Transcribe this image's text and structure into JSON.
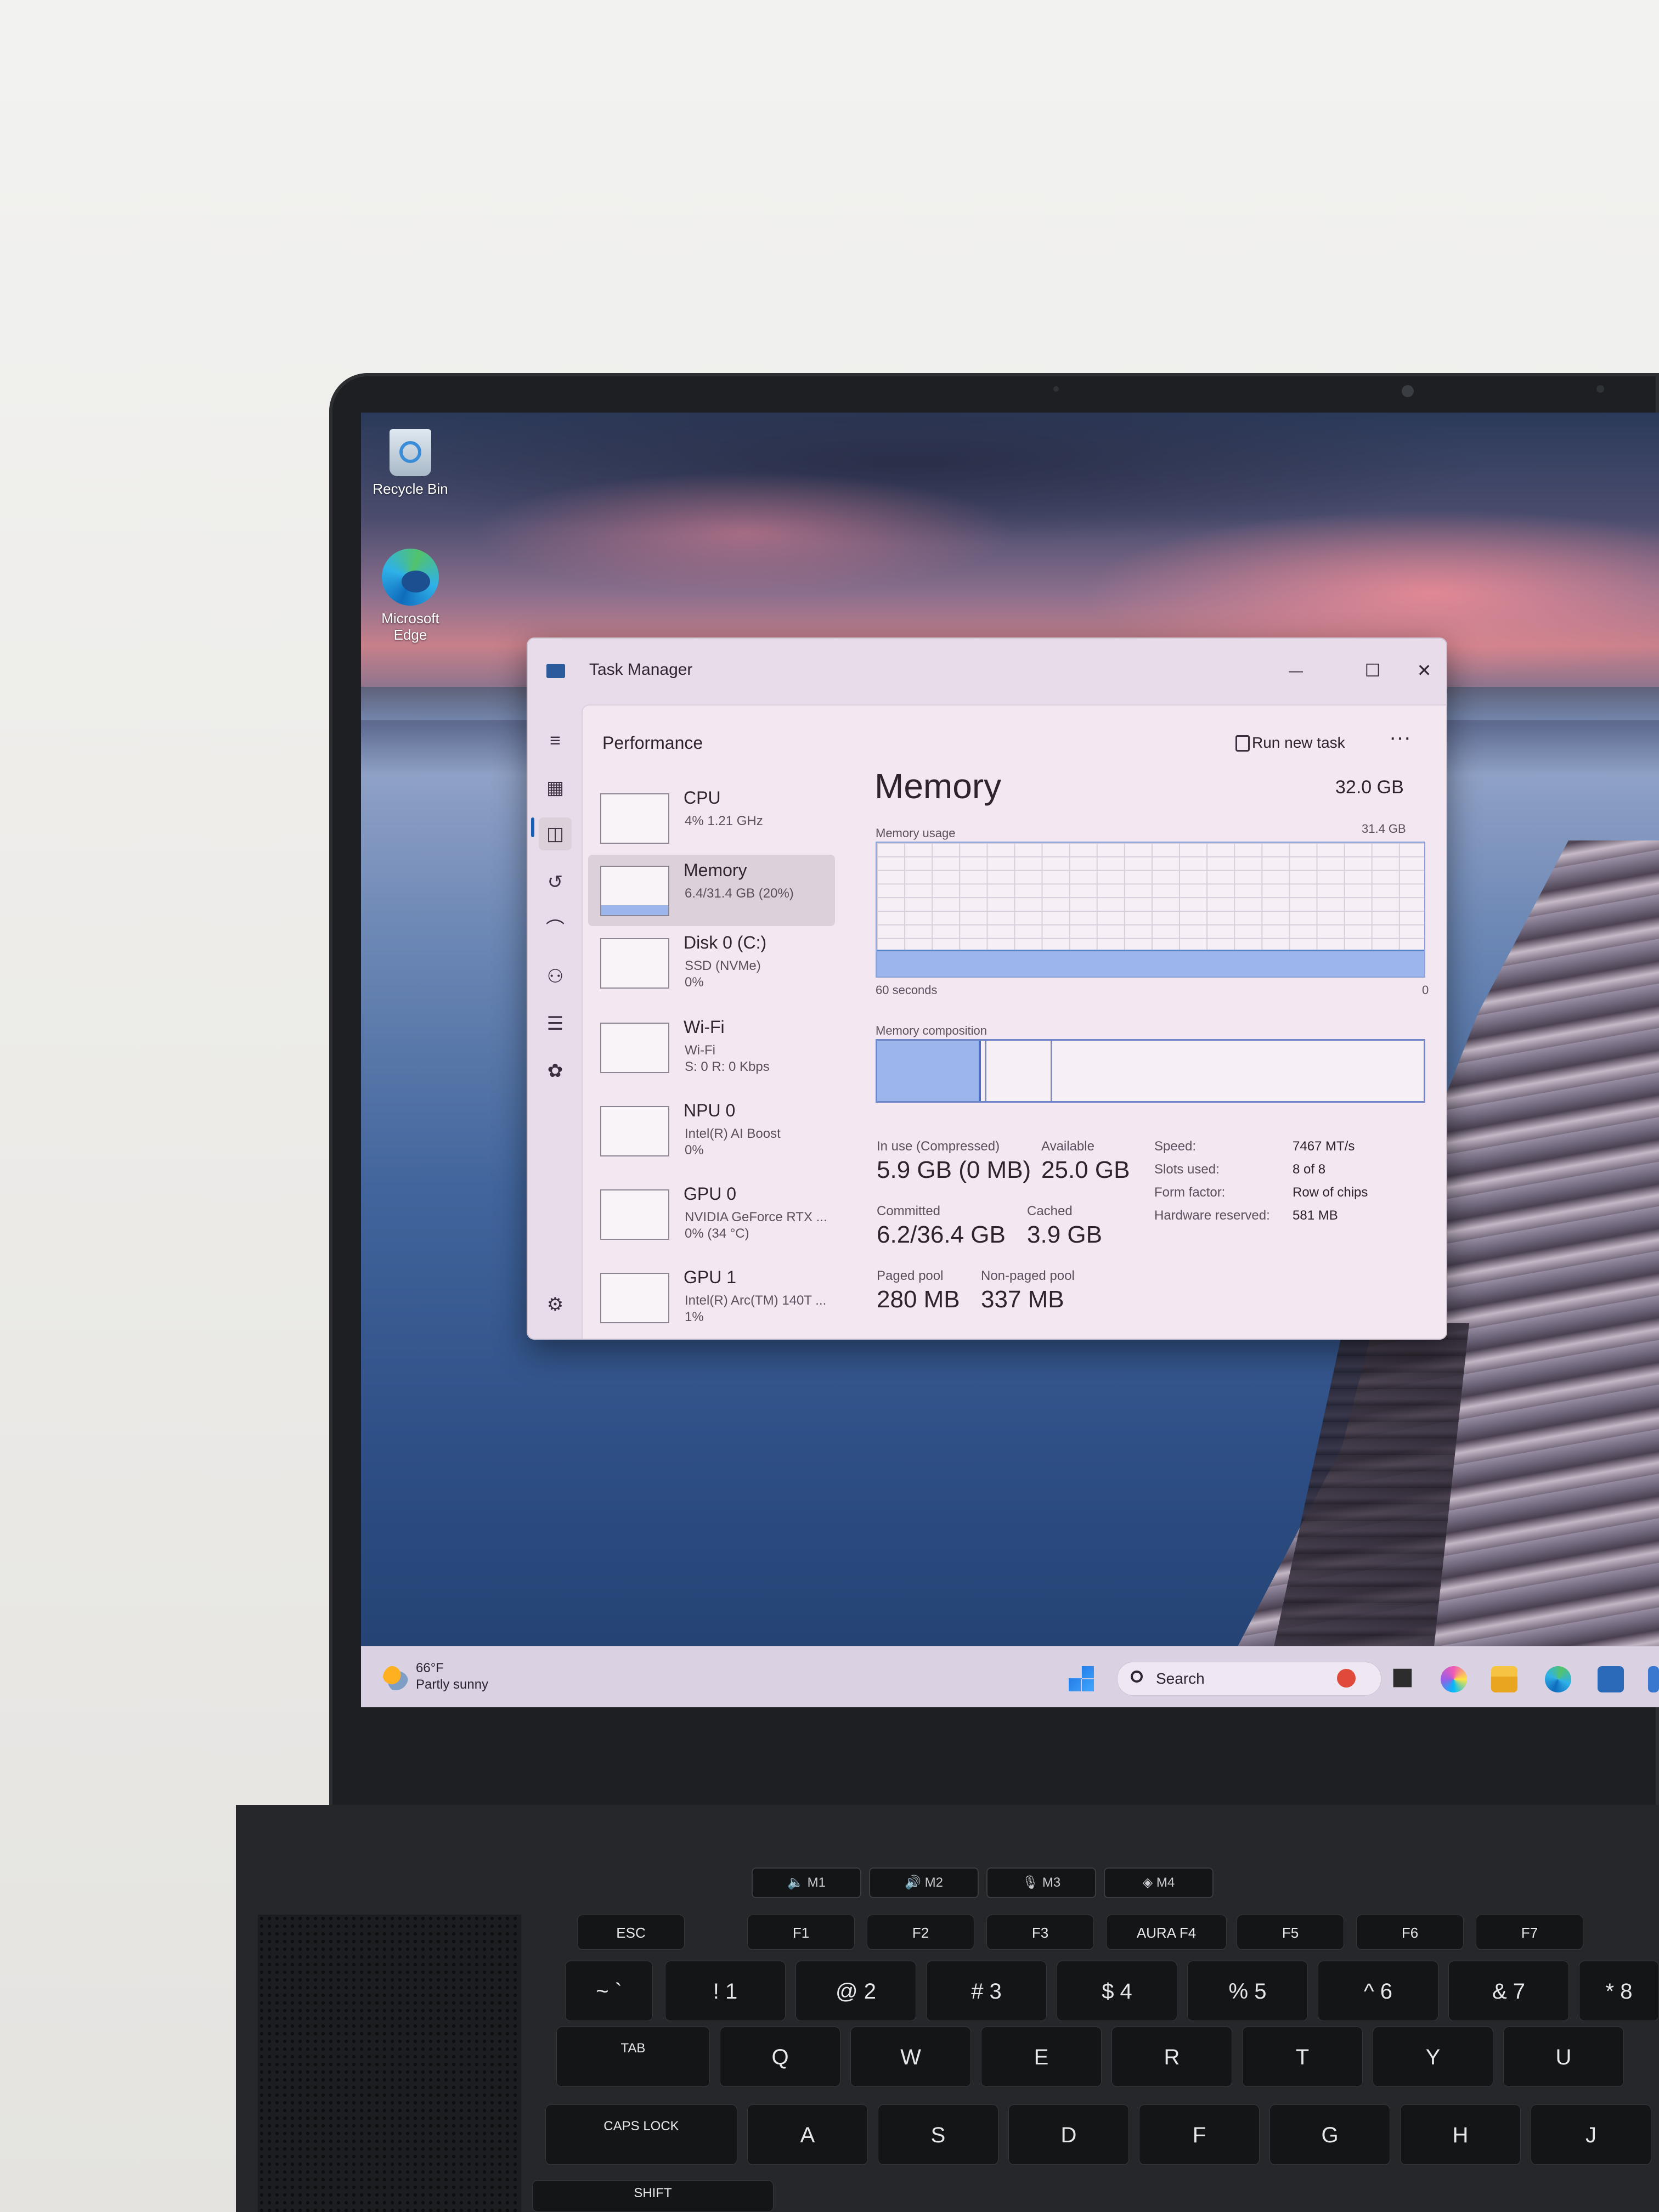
{
  "desktop": {
    "icons": [
      {
        "label": "Recycle Bin",
        "icon": "recycle-bin-icon"
      },
      {
        "label": "Microsoft\nEdge",
        "icon": "edge-icon"
      }
    ]
  },
  "window": {
    "title": "Task Manager",
    "controls": {
      "minimize": "—",
      "maximize": "☐",
      "close": "✕"
    }
  },
  "nav": {
    "rail_icons": [
      "hamburger-icon",
      "processes-icon",
      "performance-icon",
      "app-history-icon",
      "startup-icon",
      "users-icon",
      "details-icon",
      "services-icon",
      "settings-icon"
    ]
  },
  "header": {
    "page": "Performance",
    "run_task": "Run new task",
    "more": "···"
  },
  "devices": [
    {
      "name": "CPU",
      "sub1": "4%  1.21 GHz",
      "sub2": ""
    },
    {
      "name": "Memory",
      "sub1": "6.4/31.4 GB (20%)",
      "sub2": ""
    },
    {
      "name": "Disk 0 (C:)",
      "sub1": "SSD (NVMe)",
      "sub2": "0%"
    },
    {
      "name": "Wi-Fi",
      "sub1": "Wi-Fi",
      "sub2": "S: 0  R: 0 Kbps"
    },
    {
      "name": "NPU 0",
      "sub1": "Intel(R) AI Boost",
      "sub2": "0%"
    },
    {
      "name": "GPU 0",
      "sub1": "NVIDIA GeForce RTX ...",
      "sub2": "0%  (34 °C)"
    },
    {
      "name": "GPU 1",
      "sub1": "Intel(R) Arc(TM) 140T ...",
      "sub2": "1%"
    }
  ],
  "memory": {
    "title": "Memory",
    "total": "32.0 GB",
    "usage_label": "Memory usage",
    "usage_max": "31.4 GB",
    "usage_fraction": 0.2,
    "x_left": "60 seconds",
    "x_right": "0",
    "composition_label": "Memory composition",
    "composition": {
      "in_use": 0.19,
      "modified": 0.01,
      "standby": 0.12
    },
    "stats": {
      "in_use_label": "In use (Compressed)",
      "in_use": "5.9 GB (0 MB)",
      "available_label": "Available",
      "available": "25.0 GB",
      "committed_label": "Committed",
      "committed": "6.2/36.4 GB",
      "cached_label": "Cached",
      "cached": "3.9 GB",
      "paged_label": "Paged pool",
      "paged": "280 MB",
      "nonpaged_label": "Non-paged pool",
      "nonpaged": "337 MB"
    },
    "info": {
      "speed_label": "Speed:",
      "speed": "7467 MT/s",
      "slots_label": "Slots used:",
      "slots": "8 of 8",
      "form_label": "Form factor:",
      "form": "Row of chips",
      "reserved_label": "Hardware reserved:",
      "reserved": "581 MB"
    }
  },
  "taskbar": {
    "weather_temp": "66°F",
    "weather_desc": "Partly sunny",
    "search_placeholder": "Search",
    "apps": [
      "start-icon",
      "task-view-icon",
      "copilot-icon",
      "file-explorer-icon",
      "edge-icon",
      "store-icon"
    ]
  },
  "keyboard": {
    "macro_keys": [
      "M1",
      "M2",
      "M3",
      "M4"
    ],
    "fn_row": [
      "ESC",
      "F1",
      "F2",
      "F3",
      "AURA F4",
      "F5",
      "F6",
      "F7"
    ],
    "num_row": [
      "~ `",
      "! 1",
      "@ 2",
      "# 3",
      "$ 4",
      "% 5",
      "^ 6",
      "& 7",
      "* 8"
    ],
    "row_q": [
      "TAB",
      "Q",
      "W",
      "E",
      "R",
      "T",
      "Y",
      "U"
    ],
    "row_a": [
      "CAPS LOCK",
      "A",
      "S",
      "D",
      "F",
      "G",
      "H",
      "J"
    ],
    "row_z": [
      "SHIFT"
    ]
  }
}
